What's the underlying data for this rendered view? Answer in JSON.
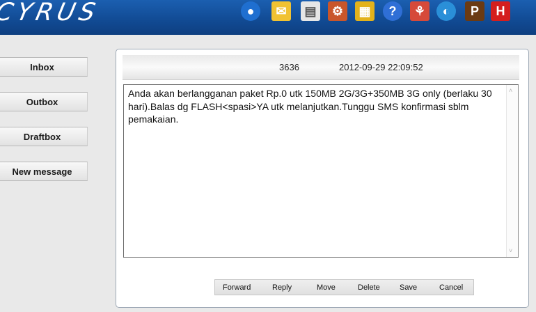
{
  "header": {
    "logo": "CYRUS",
    "icons": [
      {
        "name": "globe-icon",
        "glyph": "●",
        "bg": "#1f6fd0"
      },
      {
        "name": "envelope-icon",
        "glyph": "✉",
        "bg": "#f1c232"
      },
      {
        "name": "contacts-icon",
        "glyph": "▤",
        "bg": "#e6e6e6"
      },
      {
        "name": "settings-icon",
        "glyph": "⚙",
        "bg": "#c9562b"
      },
      {
        "name": "sim-card-icon",
        "glyph": "▦",
        "bg": "#e3b21b"
      },
      {
        "name": "help-icon",
        "glyph": "?",
        "bg": "#2f6fd6"
      },
      {
        "name": "mascot-icon",
        "glyph": "⚘",
        "bg": "#d64a3a"
      },
      {
        "name": "network-icon",
        "glyph": "◐",
        "bg": "#2a8fd8"
      },
      {
        "name": "p-icon",
        "glyph": "P",
        "bg": "#6b3a12"
      },
      {
        "name": "hot-icon",
        "glyph": "H",
        "bg": "#d41e1e"
      }
    ]
  },
  "sidebar": {
    "items": [
      {
        "label": "Inbox"
      },
      {
        "label": "Outbox"
      },
      {
        "label": "Draftbox"
      },
      {
        "label": "New message"
      }
    ]
  },
  "message": {
    "sender": "3636",
    "timestamp": "2012-09-29 22:09:52",
    "body": "Anda akan berlangganan paket Rp.0 utk 150MB 2G/3G+350MB 3G only (berlaku 30 hari).Balas dg FLASH<spasi>YA utk melanjutkan.Tunggu SMS konfirmasi sblm pemakaian."
  },
  "actions": {
    "forward": "Forward",
    "reply": "Reply",
    "move": "Move",
    "delete": "Delete",
    "save": "Save",
    "cancel": "Cancel"
  },
  "scrollbar": {
    "up": "˄",
    "down": "˅"
  }
}
